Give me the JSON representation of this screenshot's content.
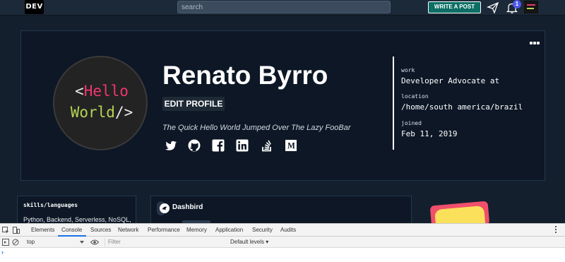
{
  "topbar": {
    "logo": "DEV",
    "search_placeholder": "search",
    "write_post_label": "WRITE A POST",
    "notification_count": "1"
  },
  "profile": {
    "avatar_line1_a": "<",
    "avatar_line1_b": "Hello",
    "avatar_line2_a": "World",
    "avatar_line2_b": "/>",
    "name": "Renato Byrro",
    "edit_label": "EDIT PROFILE",
    "tagline": "The Quick Hello World Jumped Over The Lazy FooBar",
    "socials": [
      "twitter-icon",
      "github-icon",
      "facebook-icon",
      "linkedin-icon",
      "stackoverflow-icon",
      "medium-icon"
    ],
    "work_label": "work",
    "work_value": "Developer Advocate at",
    "location_label": "location",
    "location_value": "/home/south america/brazil",
    "joined_label": "joined",
    "joined_value": "Feb 11, 2019"
  },
  "skills": {
    "title": "skills/languages",
    "text": "Python, Backend, Serverless, NoSQL,"
  },
  "feed": {
    "org_label": "Dashbird"
  },
  "devtools": {
    "tabs": [
      "Elements",
      "Console",
      "Sources",
      "Network",
      "Performance",
      "Memory",
      "Application",
      "Security",
      "Audits"
    ],
    "active_tab": "Console",
    "context": "top",
    "filter_placeholder": "Filter",
    "levels": "Default levels ▾",
    "prompt": "›"
  },
  "colors": {
    "accent": "#0c6e64",
    "background": "#141f2d",
    "card": "#0d1726",
    "pink": "#f0366f",
    "green": "#b6d454"
  }
}
